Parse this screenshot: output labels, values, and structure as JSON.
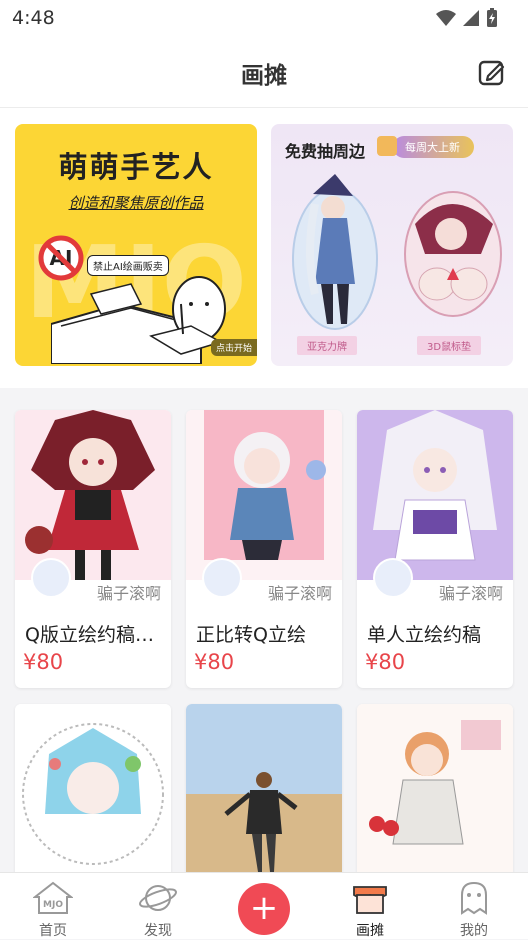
{
  "status_bar": {
    "time": "4:48"
  },
  "header": {
    "title": "画摊",
    "edit_icon": "edit-icon"
  },
  "banners": [
    {
      "title": "萌萌手艺人",
      "subtitle": "创造和聚焦原创作品",
      "badge": "禁止AI绘画贩卖",
      "tag": "点击开始",
      "watermark": "MJO"
    },
    {
      "title": "免费抽周边",
      "badge": "每周大上新",
      "items": [
        "亚克力牌",
        "3D鼠标垫"
      ]
    }
  ],
  "cards": [
    {
      "author": "骗子滚啊",
      "title": "Q版立绘约稿…",
      "price": "¥80"
    },
    {
      "author": "骗子滚啊",
      "title": "正比转Q立绘",
      "price": "¥80"
    },
    {
      "author": "骗子滚啊",
      "title": "单人立绘约稿",
      "price": "¥80"
    }
  ],
  "tabbar": {
    "items": [
      {
        "label": "首页",
        "icon": "home-icon"
      },
      {
        "label": "发现",
        "icon": "planet-icon"
      },
      {
        "label": "",
        "icon": "add-icon"
      },
      {
        "label": "画摊",
        "icon": "stall-icon"
      },
      {
        "label": "我的",
        "icon": "profile-icon"
      }
    ],
    "accent": "#f04a55"
  }
}
